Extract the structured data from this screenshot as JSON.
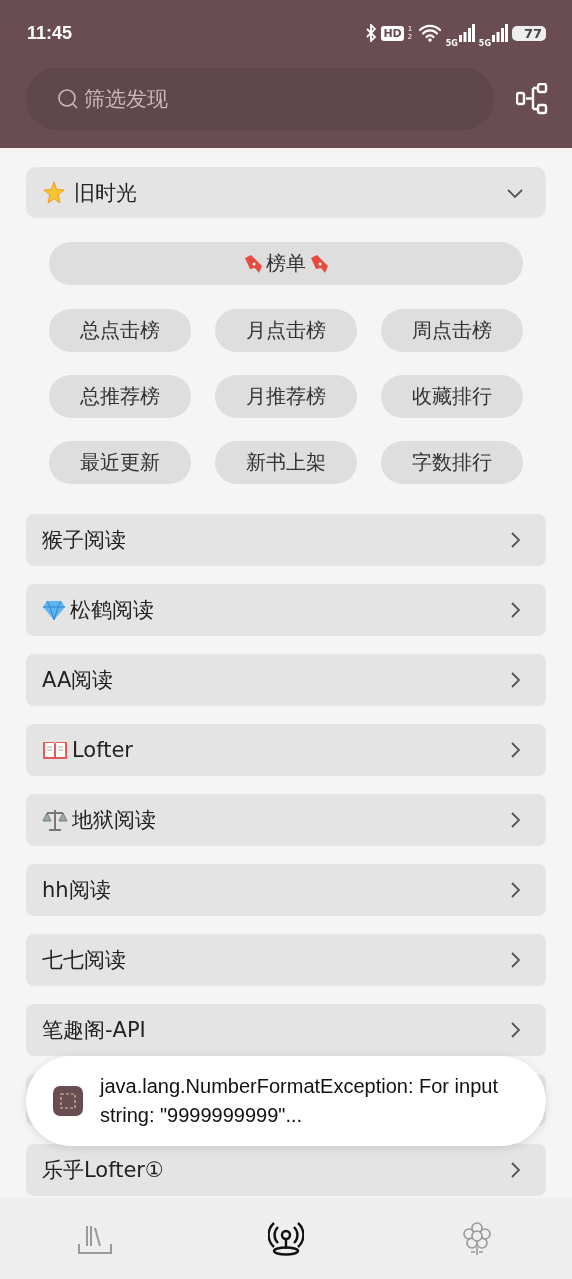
{
  "status_bar": {
    "time": "11:45",
    "hd": "HD",
    "hd_sub": "1 2",
    "networks": [
      "5G",
      "5G"
    ],
    "battery": "77"
  },
  "search": {
    "placeholder": "筛选发现"
  },
  "group": {
    "kind": "star",
    "title": "旧时光",
    "expanded": true,
    "header_chip": {
      "label": "榜单",
      "kind": "bookmark"
    },
    "chips": [
      "总点击榜",
      "月点击榜",
      "周点击榜",
      "总推荐榜",
      "月推荐榜",
      "收藏排行",
      "最近更新",
      "新书上架",
      "字数排行"
    ]
  },
  "sources": [
    {
      "kind": "plain",
      "label": "猴子阅读"
    },
    {
      "kind": "gem",
      "label": "松鹤阅读"
    },
    {
      "kind": "plain",
      "label": "AA阅读"
    },
    {
      "kind": "book",
      "label": "Lofter"
    },
    {
      "kind": "scale",
      "label": "地狱阅读"
    },
    {
      "kind": "plain",
      "label": "hh阅读"
    },
    {
      "kind": "plain",
      "label": "七七阅读"
    },
    {
      "kind": "plain",
      "label": "笔趣阁-API"
    },
    {
      "kind": "covered"
    },
    {
      "kind": "plain",
      "label": "乐乎Lofter①"
    }
  ],
  "toast": {
    "message": "java.lang.NumberFormatException: For input string: \"9999999999\"..."
  },
  "nav": [
    {
      "kind": "shelf",
      "selected": false
    },
    {
      "kind": "discover",
      "selected": true
    },
    {
      "kind": "profile",
      "selected": false
    }
  ]
}
